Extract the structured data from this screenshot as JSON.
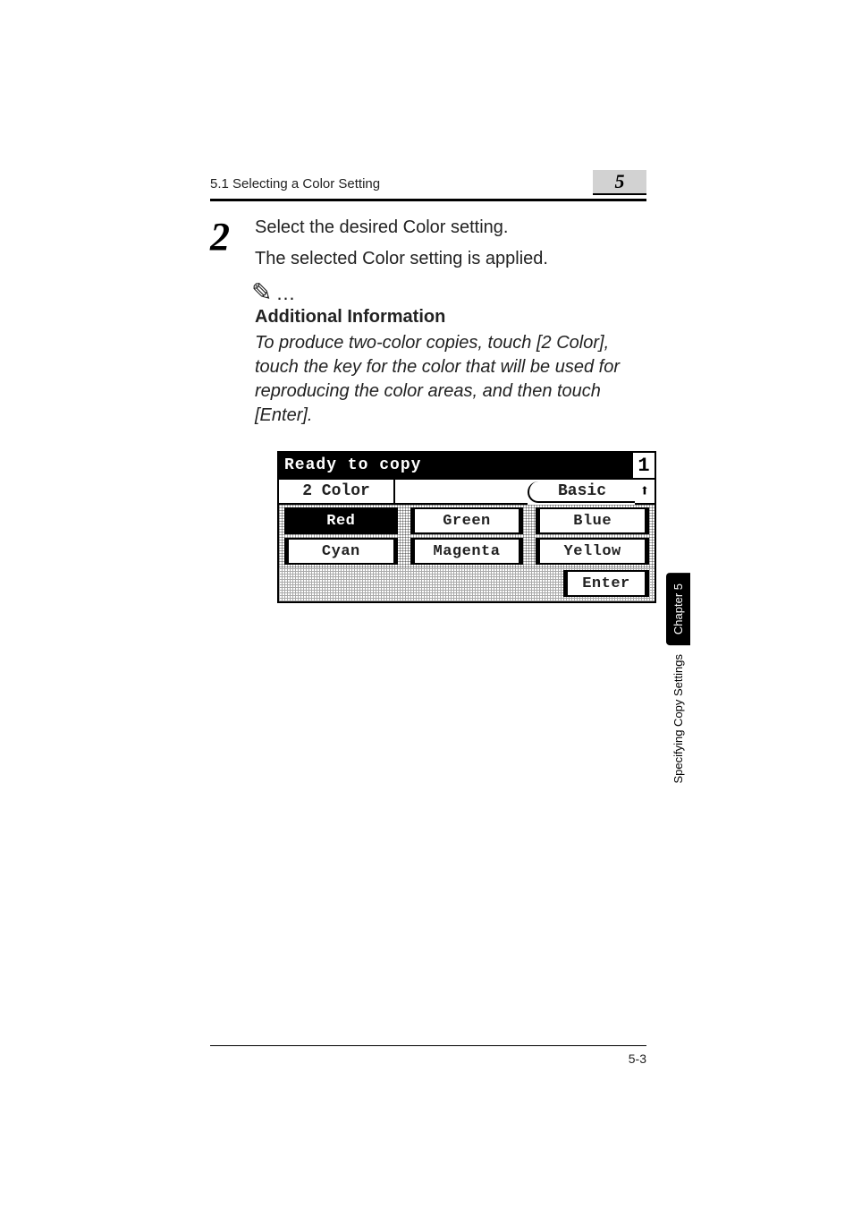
{
  "header": {
    "section_title": "5.1 Selecting a Color Setting",
    "chapter_number": "5"
  },
  "step": {
    "number": "2",
    "line1": "Select the desired Color setting.",
    "line2": "The selected Color setting is applied."
  },
  "note": {
    "icon": "✎",
    "heading": "Additional Information",
    "body": "To produce two-color copies, touch [2 Color], touch the key for the color that will be used for reproducing the color areas, and then touch [Enter]."
  },
  "lcd": {
    "ready": "Ready to copy",
    "copies": "1",
    "tab_2color": "2 Color",
    "tab_basic": "Basic",
    "buttons": [
      {
        "label": "Red",
        "selected": true
      },
      {
        "label": "Green",
        "selected": false
      },
      {
        "label": "Blue",
        "selected": false
      },
      {
        "label": "Cyan",
        "selected": false
      },
      {
        "label": "Magenta",
        "selected": false
      },
      {
        "label": "Yellow",
        "selected": false
      }
    ],
    "enter": "Enter"
  },
  "side": {
    "chapter_label": "Chapter 5",
    "section_label": "Specifying Copy Settings"
  },
  "footer": {
    "page": "5-3"
  }
}
